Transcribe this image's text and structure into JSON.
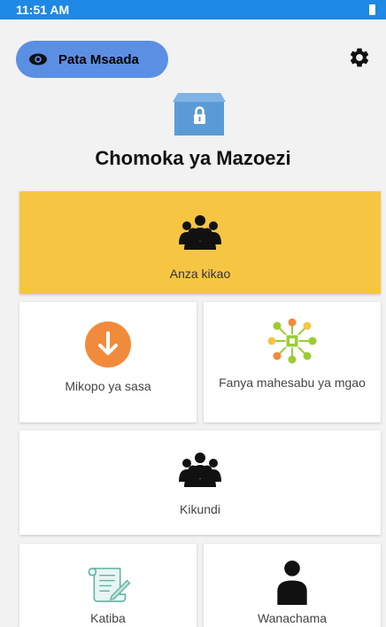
{
  "status_bar": {
    "time": "11:51 AM",
    "battery_icon": "battery-icon"
  },
  "header": {
    "help_button": {
      "label": "Pata Msaada",
      "icon": "eye-icon"
    },
    "settings_icon": "gear-icon"
  },
  "app": {
    "title": "Chomoka ya Mazoezi",
    "logo_icon": "locked-box-icon"
  },
  "tiles": {
    "start_meeting": {
      "label": "Anza kikao",
      "icon": "group-icon"
    },
    "current_loans": {
      "label": "Mikopo ya sasa",
      "icon": "download-arrow-icon"
    },
    "dividend_calc": {
      "label": "Fanya mahesabu ya mgao",
      "icon": "network-icon"
    },
    "group": {
      "label": "Kikundi",
      "icon": "group-icon"
    },
    "charter": {
      "label": "Katiba",
      "icon": "scroll-icon"
    },
    "members": {
      "label": "Wanachama",
      "icon": "person-icon"
    }
  },
  "colors": {
    "status_bar": "#1e88e5",
    "help_button": "#5b8fe3",
    "start_tile": "#f6c542",
    "loans_icon": "#f28a3c",
    "box_icon": "#5b9bd5"
  }
}
